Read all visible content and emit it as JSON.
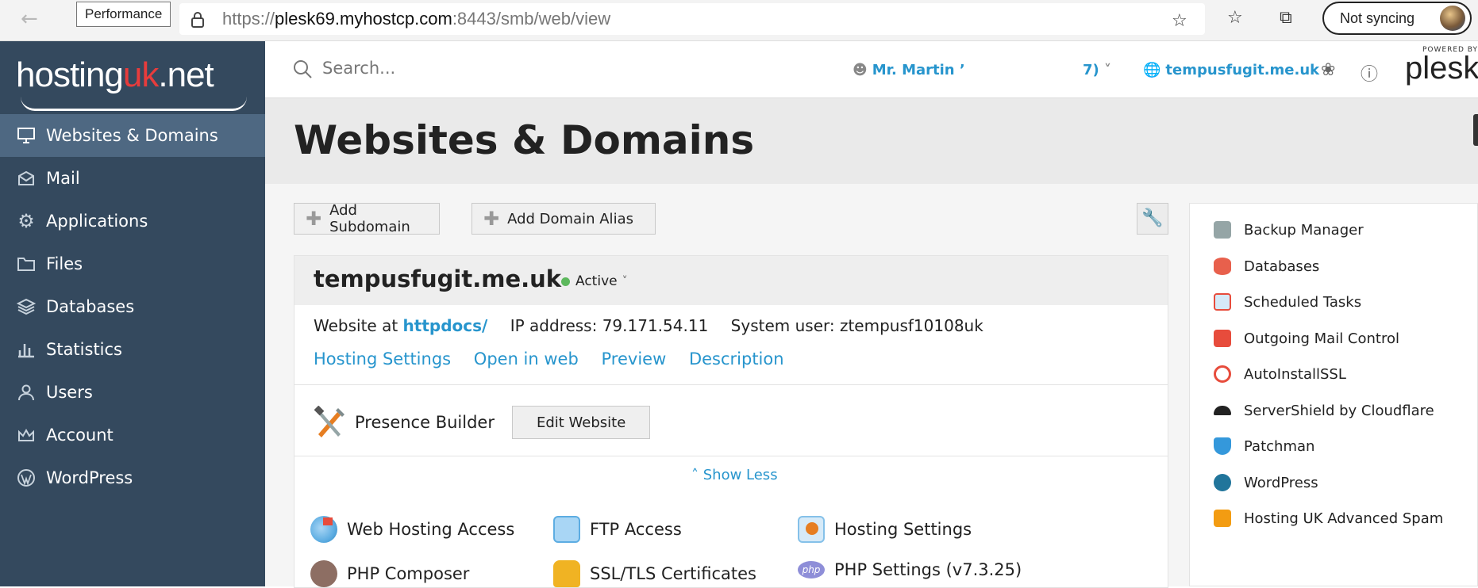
{
  "browser": {
    "tooltip": "Performance",
    "url_prefix": "https://",
    "url_host": "plesk69.myhostcp.com",
    "url_path": ":8443/smb/web/view",
    "sync_label": "Not syncing"
  },
  "sidebar": {
    "logo_main": "hosting",
    "logo_uk": "uk",
    "logo_net": ".net",
    "items": [
      {
        "label": "Websites & Domains",
        "icon": "monitor-icon",
        "active": true
      },
      {
        "label": "Mail",
        "icon": "envelope-icon"
      },
      {
        "label": "Applications",
        "icon": "gear-icon"
      },
      {
        "label": "Files",
        "icon": "folder-icon"
      },
      {
        "label": "Databases",
        "icon": "layers-icon"
      },
      {
        "label": "Statistics",
        "icon": "bar-chart-icon"
      },
      {
        "label": "Users",
        "icon": "user-icon"
      },
      {
        "label": "Account",
        "icon": "crown-icon"
      },
      {
        "label": "WordPress",
        "icon": "wordpress-icon"
      }
    ]
  },
  "topbar": {
    "search_placeholder": "Search...",
    "user_name": "Mr. Martin ’",
    "user_suffix": "7)",
    "domain": "tempusfugit.me.uk",
    "plesk_powered": "POWERED BY",
    "plesk_name": "plesk"
  },
  "page": {
    "title": "Websites & Domains",
    "add_subdomain": "Add Subdomain",
    "add_alias": "Add Domain Alias"
  },
  "domain_card": {
    "name": "tempusfugit.me.uk",
    "status": "Active",
    "website_at_label": "Website at",
    "website_at_link": "httpdocs/",
    "ip_label": "IP address:",
    "ip_value": "79.171.54.11",
    "sysuser_label": "System user:",
    "sysuser_value": "ztempusf10108uk",
    "links": [
      "Hosting Settings",
      "Open in web",
      "Preview",
      "Description"
    ],
    "presence_label": "Presence Builder",
    "edit_website": "Edit Website",
    "show_less": "Show Less",
    "features": [
      {
        "label": "Web Hosting Access",
        "icon": "globe-flag-icon",
        "color": "#e74c3c"
      },
      {
        "label": "FTP Access",
        "icon": "ftp-folder-icon",
        "color": "#5dade2"
      },
      {
        "label": "Hosting Settings",
        "icon": "hosting-settings-icon",
        "color": "#e67e22"
      },
      {
        "label": "PHP Composer",
        "icon": "composer-icon",
        "color": "#6d4c41"
      },
      {
        "label": "SSL/TLS Certificates",
        "icon": "padlock-icon",
        "color": "#f0b323"
      },
      {
        "label": "PHP Settings (v7.3.25)",
        "icon": "php-icon",
        "color": "#8e8ed8"
      }
    ]
  },
  "right_panel": {
    "items": [
      {
        "label": "Backup Manager",
        "icon": "backup-icon",
        "color": "#7f8c8d"
      },
      {
        "label": "Databases",
        "icon": "database-icon",
        "color": "#e8604c"
      },
      {
        "label": "Scheduled Tasks",
        "icon": "calendar-icon",
        "color": "#3498db"
      },
      {
        "label": "Outgoing Mail Control",
        "icon": "mail-icon",
        "color": "#e74c3c"
      },
      {
        "label": "AutoInstallSSL",
        "icon": "ssl-badge-icon",
        "color": "#e74c3c"
      },
      {
        "label": "ServerShield by Cloudflare",
        "icon": "cloud-icon",
        "color": "#222222"
      },
      {
        "label": "Patchman",
        "icon": "shield-plus-icon",
        "color": "#3498db"
      },
      {
        "label": "WordPress",
        "icon": "wordpress-icon",
        "color": "#21759b"
      },
      {
        "label": "Hosting UK Advanced Spam",
        "icon": "spam-icon",
        "color": "#f39c12"
      }
    ]
  }
}
